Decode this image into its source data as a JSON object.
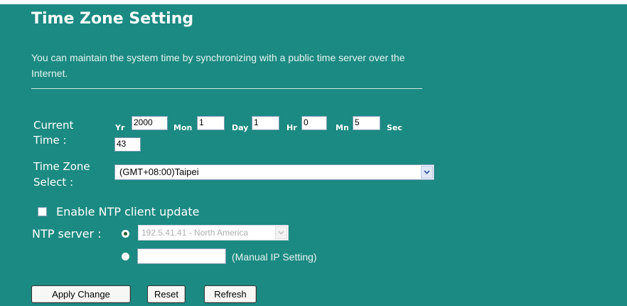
{
  "title": "Time Zone Setting",
  "description": "You can maintain the system time by synchronizing with a public time server over the Internet.",
  "current_time": {
    "label_line1": "Current",
    "label_line2": "Time :",
    "yr_label": "Yr",
    "yr_value": "2000",
    "mon_label": "Mon",
    "mon_value": "1",
    "day_label": "Day",
    "day_value": "1",
    "hr_label": "Hr",
    "hr_value": "0",
    "mn_label": "Mn",
    "mn_value": "5",
    "sec_label": "Sec",
    "sec_value": "43"
  },
  "time_zone": {
    "label_line1": "Time Zone",
    "label_line2": "Select :",
    "selected": "(GMT+08:00)Taipei"
  },
  "ntp": {
    "enable_label": "Enable NTP client update",
    "enable_checked": false,
    "server_label": "NTP server :",
    "server_selected": "192.5.41.41 - North America",
    "manual_value": "",
    "manual_label": "(Manual IP Setting)"
  },
  "buttons": {
    "apply": "Apply Change",
    "reset": "Reset",
    "refresh": "Refresh"
  },
  "colors": {
    "panel_bg": "#1b8a82",
    "text": "#ffffff"
  }
}
